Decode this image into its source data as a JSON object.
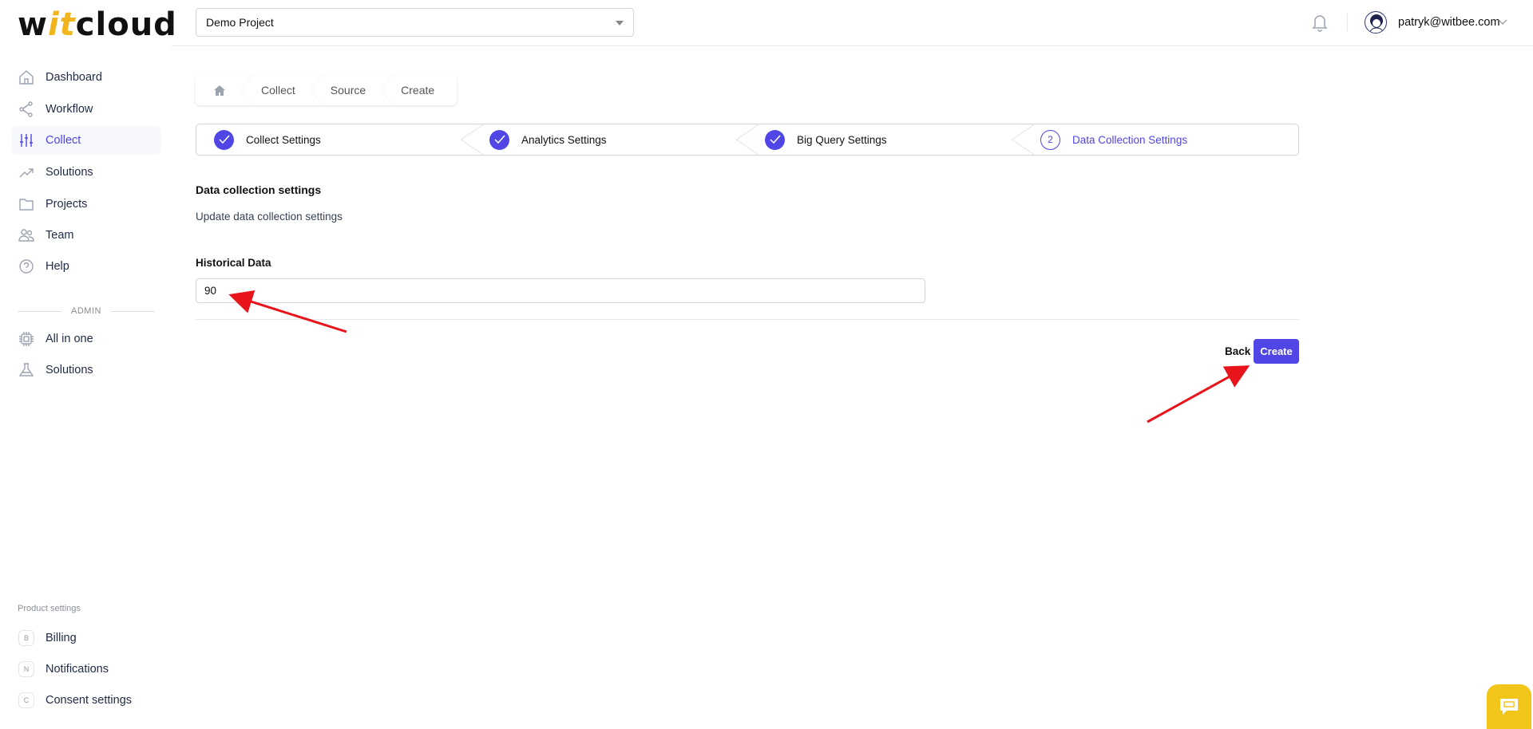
{
  "logo": {
    "prefix": "w",
    "accent": "it",
    "suffix": "cloud"
  },
  "header": {
    "project": "Demo Project",
    "user_email": "patryk@witbee.com"
  },
  "sidebar": {
    "items": [
      {
        "label": "Dashboard",
        "icon": "home-icon"
      },
      {
        "label": "Workflow",
        "icon": "share-icon"
      },
      {
        "label": "Collect",
        "icon": "sliders-icon",
        "active": true
      },
      {
        "label": "Solutions",
        "icon": "trending-up-icon"
      },
      {
        "label": "Projects",
        "icon": "folder-icon"
      },
      {
        "label": "Team",
        "icon": "users-icon"
      },
      {
        "label": "Help",
        "icon": "help-icon"
      }
    ],
    "admin_label": "ADMIN",
    "admin_items": [
      {
        "label": "All in one",
        "icon": "chip-icon"
      },
      {
        "label": "Solutions",
        "icon": "flask-icon"
      }
    ],
    "product_settings_label": "Product settings",
    "product_items": [
      {
        "letter": "B",
        "label": "Billing"
      },
      {
        "letter": "N",
        "label": "Notifications"
      },
      {
        "letter": "C",
        "label": "Consent settings"
      }
    ]
  },
  "breadcrumb": [
    "Collect",
    "Source",
    "Create"
  ],
  "steps": [
    {
      "label": "Collect Settings",
      "status": "done"
    },
    {
      "label": "Analytics Settings",
      "status": "done"
    },
    {
      "label": "Big Query Settings",
      "status": "done"
    },
    {
      "label": "Data Collection Settings",
      "status": "current",
      "number": "2"
    }
  ],
  "form": {
    "title": "Data collection settings",
    "subtitle": "Update data collection settings",
    "historical_label": "Historical Data",
    "historical_value": "90"
  },
  "actions": {
    "back": "Back",
    "create": "Create"
  },
  "colors": {
    "accent": "#4f46e5",
    "logo_accent": "#f2b51d",
    "chat": "#f2c519",
    "annotation": "#e8141b"
  }
}
